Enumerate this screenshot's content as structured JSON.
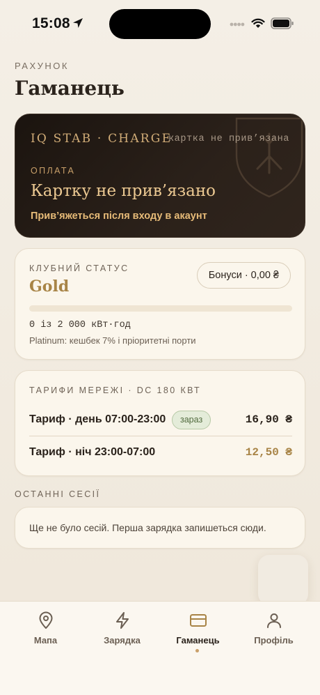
{
  "status_bar": {
    "time": "15:08"
  },
  "header": {
    "eyebrow": "РАХУНОК",
    "title": "Гаманець"
  },
  "payment_card": {
    "brand": "IQ STAB · CHARGE",
    "note": "картка не прив’язана",
    "eyebrow": "ОПЛАТА",
    "title": "Картку не прив’язано",
    "subtitle": "Прив’яжеться після входу в акаунт"
  },
  "club": {
    "eyebrow": "КЛУБНИЙ СТАТУС",
    "level": "Gold",
    "bonus_label": "Бонуси · 0,00 ₴",
    "progress": 0,
    "usage": "0 із 2 000 кВт·год",
    "next_level": "Platinum: кешбек 7% і пріоритетні порти"
  },
  "tariffs": {
    "eyebrow": "ТАРИФИ МЕРЕЖІ · DC 180 КВТ",
    "rows": [
      {
        "label": "Тариф · день 07:00-23:00",
        "badge": "зараз",
        "price": "16,90 ₴"
      },
      {
        "label": "Тариф · ніч 23:00-07:00",
        "price": "12,50 ₴"
      }
    ]
  },
  "sessions": {
    "eyebrow": "ОСТАННІ СЕСІЇ",
    "empty": "Ще не було сесій. Перша зарядка запишеться сюди."
  },
  "tab_bar": {
    "items": [
      {
        "label": "Мапа",
        "icon": "map-pin-icon"
      },
      {
        "label": "Зарядка",
        "icon": "lightning-icon"
      },
      {
        "label": "Гаманець",
        "icon": "wallet-card-icon",
        "active": true
      },
      {
        "label": "Профіль",
        "icon": "user-icon"
      }
    ]
  },
  "colors": {
    "accent_gold": "#c9a06a",
    "dark_card": "#1b140f",
    "badge_green": "#516b3e"
  }
}
